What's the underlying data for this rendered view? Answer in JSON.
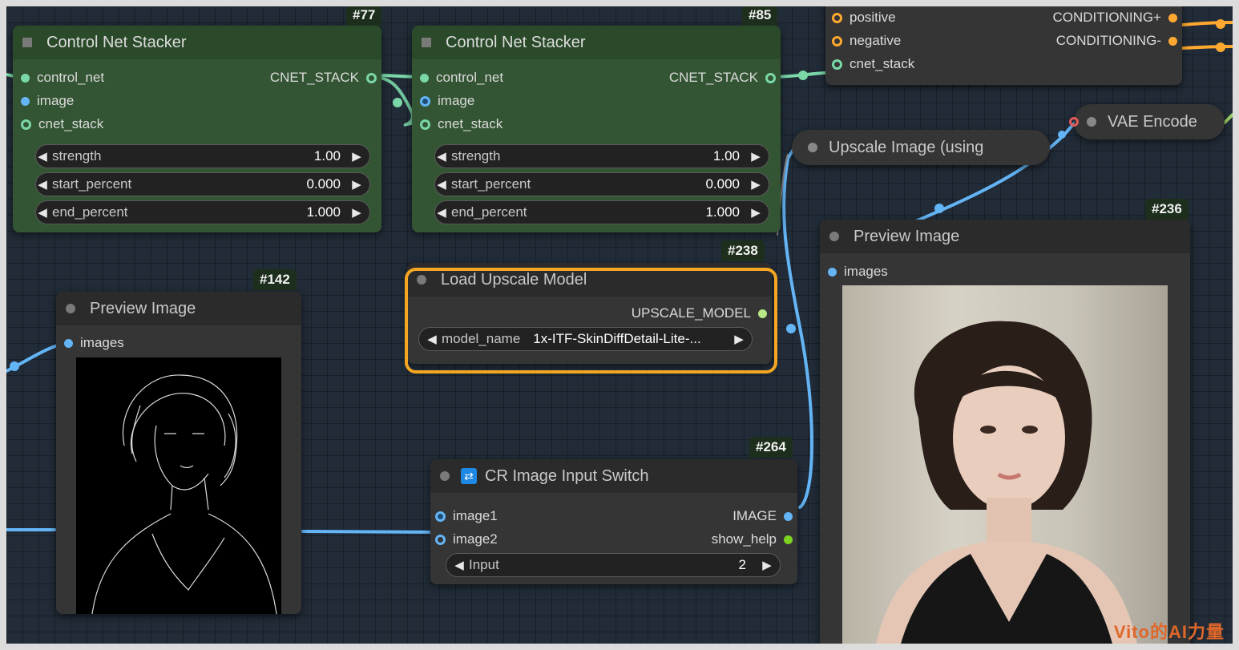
{
  "nodes": {
    "cns77": {
      "id": "#77",
      "title": "Control Net Stacker",
      "in": [
        "control_net",
        "image",
        "cnet_stack"
      ],
      "out": "CNET_STACK",
      "widgets": [
        {
          "name": "strength",
          "value": "1.00"
        },
        {
          "name": "start_percent",
          "value": "0.000"
        },
        {
          "name": "end_percent",
          "value": "1.000"
        }
      ]
    },
    "cns85": {
      "id": "#85",
      "title": "Control Net Stacker",
      "in": [
        "control_net",
        "image",
        "cnet_stack"
      ],
      "out": "CNET_STACK",
      "widgets": [
        {
          "name": "strength",
          "value": "1.00"
        },
        {
          "name": "start_percent",
          "value": "0.000"
        },
        {
          "name": "end_percent",
          "value": "1.000"
        }
      ]
    },
    "apply": {
      "in": [
        "positive",
        "negative",
        "cnet_stack"
      ],
      "out": [
        "CONDITIONING+",
        "CONDITIONING-"
      ]
    },
    "upscale_image": {
      "title": "Upscale Image (using"
    },
    "vae_encode": {
      "title": "VAE Encode"
    },
    "preview236": {
      "id": "#236",
      "title": "Preview Image",
      "in": "images"
    },
    "load_upscale": {
      "id": "#238",
      "title": "Load Upscale Model",
      "out": "UPSCALE_MODEL",
      "widget": {
        "name": "model_name",
        "value": "1x-ITF-SkinDiffDetail-Lite-..."
      }
    },
    "preview142": {
      "id": "#142",
      "title": "Preview Image",
      "in": "images"
    },
    "switch264": {
      "id": "#264",
      "title": "CR Image Input Switch",
      "in": [
        "image1",
        "image2"
      ],
      "out": [
        "IMAGE",
        "show_help"
      ],
      "widget": {
        "name": "Input",
        "value": "2"
      }
    }
  },
  "colors": {
    "cnet": "#7ad8a8",
    "image": "#64b5f6",
    "conditioning": "#ffa931",
    "upscale_model": "#b8e986",
    "highlight": "#f5a623"
  },
  "watermark": "Vito的AI力量"
}
